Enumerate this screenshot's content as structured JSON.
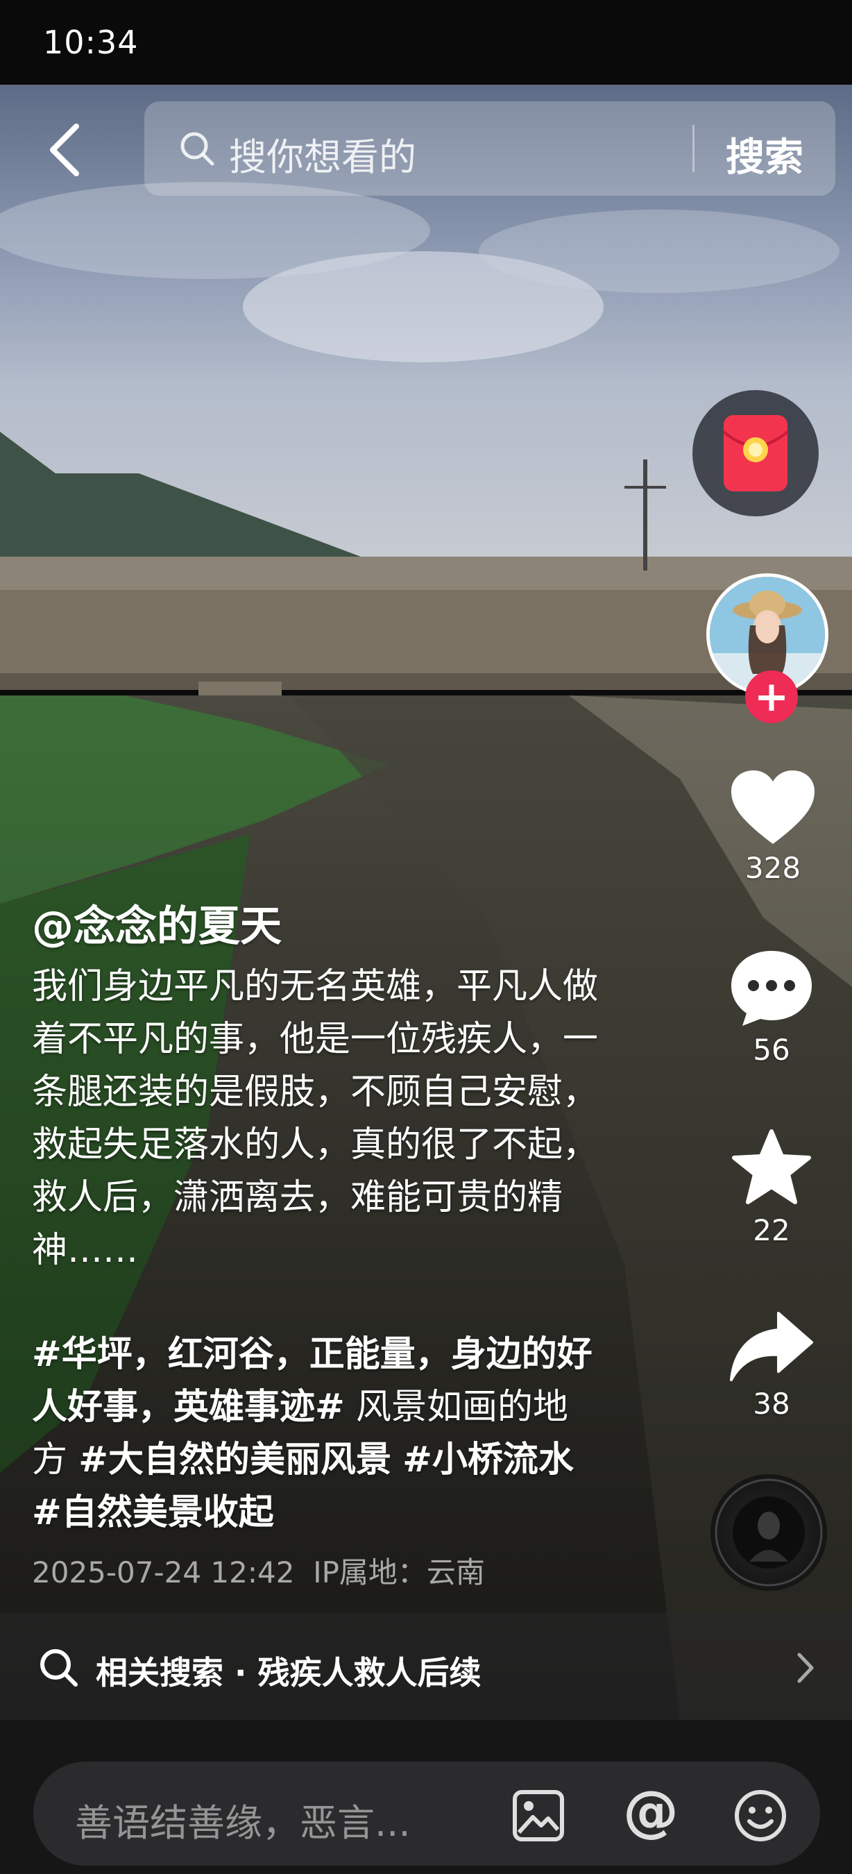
{
  "status_bar": {
    "time": "10:34"
  },
  "search": {
    "placeholder": "搜你想看的",
    "submit_label": "搜索"
  },
  "side_actions": {
    "like_count": "328",
    "comment_count": "56",
    "favorite_count": "22",
    "share_count": "38",
    "follow_label": "+"
  },
  "post": {
    "author": "@念念的夏天",
    "caption": "我们身边平凡的无名英雄，平凡人做着不平凡的事，他是一位残疾人，一条腿还装的是假肢，不顾自己安慰，救起失足落水的人，真的很了不起，救人后，潇洒离去，难能可贵的精神……",
    "tags": [
      {
        "text": "#华坪，红河谷，正能量，身边的好人好事，英雄事迹#",
        "bold": true
      },
      {
        "text": " 风景如画的地方 ",
        "bold": false
      },
      {
        "text": "#大自然的美丽风景",
        "bold": true
      },
      {
        "text": " ",
        "bold": false
      },
      {
        "text": "#小桥流水",
        "bold": true
      },
      {
        "text": " ",
        "bold": false
      },
      {
        "text": "#自然美景收起",
        "bold": true
      }
    ],
    "datetime": "2025-07-24 12:42",
    "ip_location": "IP属地：云南"
  },
  "related_search": {
    "text": "相关搜索 · 残疾人救人后续"
  },
  "comment_bar": {
    "placeholder": "善语结善缘，恶言..."
  },
  "colors": {
    "accent_red": "#ee2c55",
    "bottom_bg": "#161616"
  },
  "icons": [
    "back-icon",
    "search-icon",
    "red-packet-icon",
    "heart-icon",
    "comment-icon",
    "star-icon",
    "share-icon",
    "music-disc-icon",
    "image-icon",
    "at-icon",
    "emoji-icon",
    "chevron-right-icon"
  ]
}
